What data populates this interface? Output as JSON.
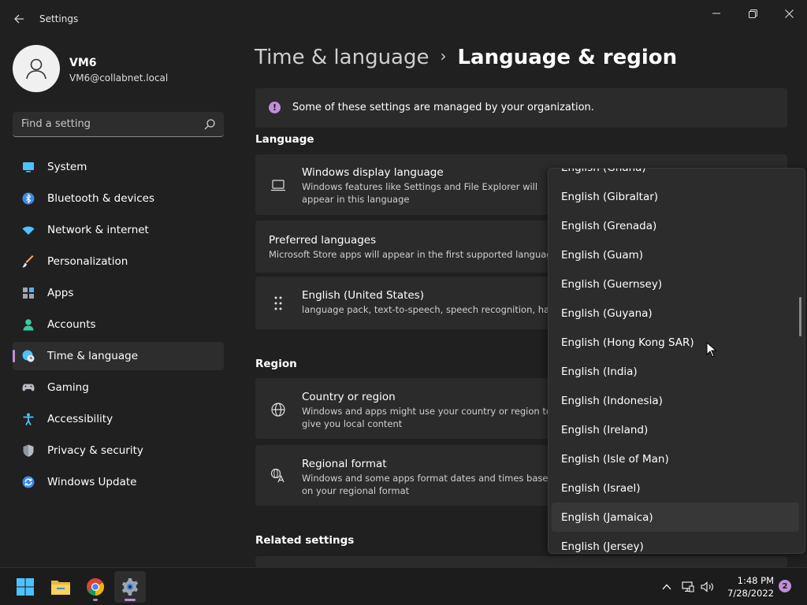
{
  "window": {
    "title": "Settings"
  },
  "profile": {
    "name": "VM6",
    "email": "VM6@collabnet.local"
  },
  "search": {
    "placeholder": "Find a setting"
  },
  "nav": {
    "items": [
      {
        "label": "System",
        "icon": "monitor-icon"
      },
      {
        "label": "Bluetooth & devices",
        "icon": "bluetooth-icon"
      },
      {
        "label": "Network & internet",
        "icon": "wifi-icon"
      },
      {
        "label": "Personalization",
        "icon": "brush-icon"
      },
      {
        "label": "Apps",
        "icon": "apps-icon"
      },
      {
        "label": "Accounts",
        "icon": "person-icon"
      },
      {
        "label": "Time & language",
        "icon": "globe-clock-icon",
        "selected": true
      },
      {
        "label": "Gaming",
        "icon": "gamepad-icon"
      },
      {
        "label": "Accessibility",
        "icon": "accessibility-icon"
      },
      {
        "label": "Privacy & security",
        "icon": "shield-icon"
      },
      {
        "label": "Windows Update",
        "icon": "update-icon"
      }
    ]
  },
  "breadcrumb": {
    "parent": "Time & language",
    "separator": "›",
    "current": "Language & region"
  },
  "info": {
    "text": "Some of these settings are managed by your organization."
  },
  "language": {
    "heading": "Language",
    "display": {
      "title": "Windows display language",
      "subtitle": "Windows features like Settings and File Explorer will appear in this language"
    },
    "preferred": {
      "title": "Preferred languages",
      "subtitle": "Microsoft Store apps will appear in the first supported language in this list"
    },
    "english_us": {
      "title": "English (United States)",
      "subtitle": "language pack, text-to-speech, speech recognition, handwriting, basic typing"
    }
  },
  "region": {
    "heading": "Region",
    "country": {
      "title": "Country or region",
      "subtitle": "Windows and apps might use your country or region to give you local content"
    },
    "format": {
      "title": "Regional format",
      "subtitle": "Windows and some apps format dates and times based on your regional format"
    }
  },
  "related": {
    "heading": "Related settings"
  },
  "dropdown": {
    "items": [
      "English (Ghana)",
      "English (Gibraltar)",
      "English (Grenada)",
      "English (Guam)",
      "English (Guernsey)",
      "English (Guyana)",
      "English (Hong Kong SAR)",
      "English (India)",
      "English (Indonesia)",
      "English (Ireland)",
      "English (Isle of Man)",
      "English (Israel)",
      "English (Jamaica)",
      "English (Jersey)"
    ],
    "hovered": "English (Jamaica)"
  },
  "taskbar": {
    "apps": [
      "start-icon",
      "file-explorer-icon",
      "chrome-icon",
      "settings-icon"
    ],
    "time": "1:48 PM",
    "date": "7/28/2022",
    "notifications": "2"
  },
  "colors": {
    "accent": "#c28dd8",
    "background": "#202020",
    "card": "#2b2b2b"
  }
}
